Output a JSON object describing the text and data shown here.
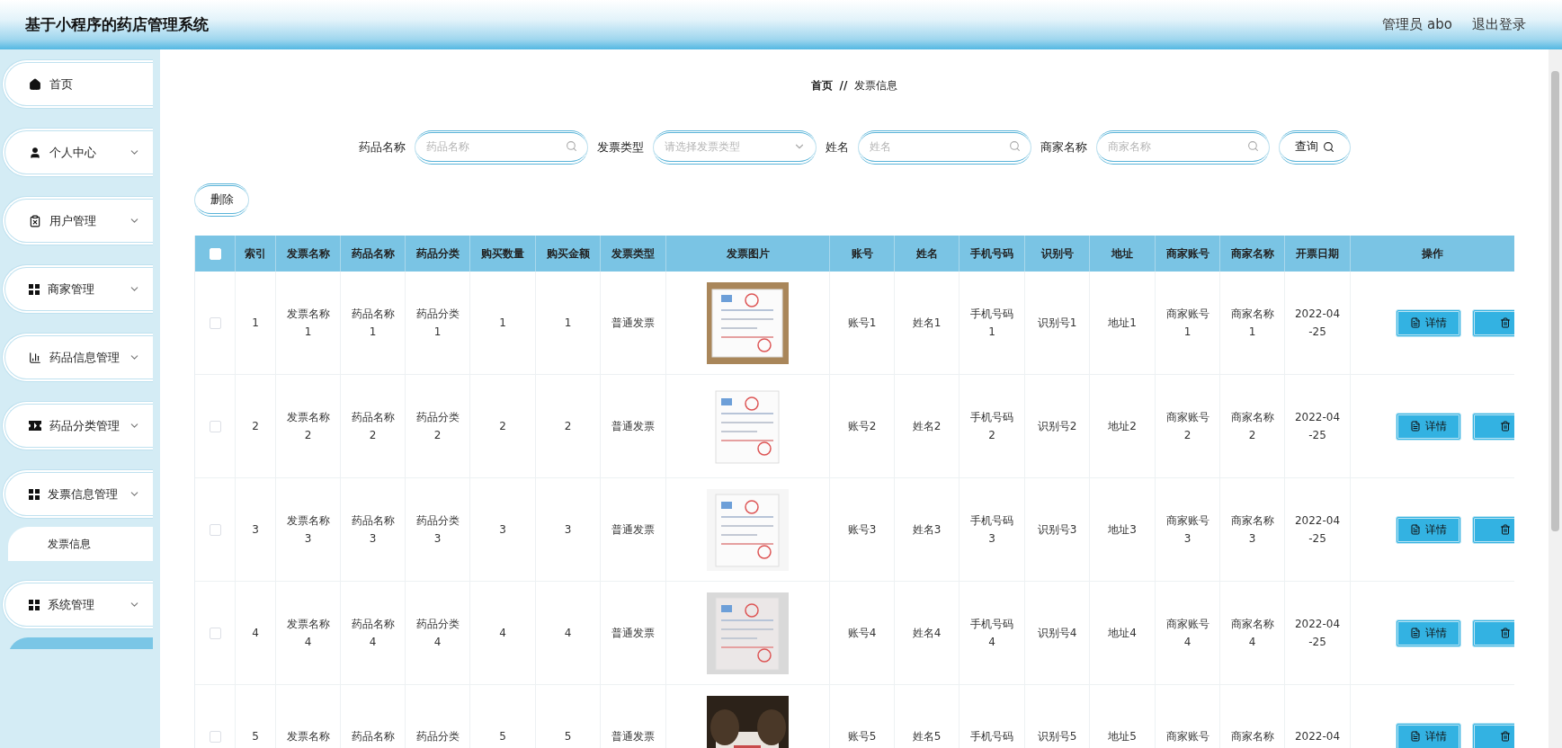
{
  "header": {
    "title": "基于小程序的药店管理系统",
    "user": "管理员 abo",
    "logout": "退出登录"
  },
  "sidebar": {
    "items": [
      {
        "label": "首页",
        "kind": "link"
      },
      {
        "label": "个人中心",
        "kind": "menu"
      },
      {
        "label": "用户管理",
        "kind": "menu"
      },
      {
        "label": "商家管理",
        "kind": "menu"
      },
      {
        "label": "药品信息管理",
        "kind": "menu"
      },
      {
        "label": "药品分类管理",
        "kind": "menu"
      },
      {
        "label": "发票信息管理",
        "kind": "menu",
        "children": [
          {
            "label": "发票信息",
            "selected": false
          }
        ]
      },
      {
        "label": "系统管理",
        "kind": "menu",
        "children": [
          {
            "selected": true
          }
        ]
      }
    ]
  },
  "breadcrumb": {
    "items": [
      "首页",
      "发票信息"
    ],
    "separator": "//"
  },
  "search": {
    "fields": [
      {
        "label": "药品名称",
        "placeholder": "药品名称",
        "kind": "text"
      },
      {
        "label": "发票类型",
        "placeholder": "请选择发票类型",
        "kind": "select"
      },
      {
        "label": "姓名",
        "placeholder": "姓名",
        "kind": "text"
      },
      {
        "label": "商家名称",
        "placeholder": "商家名称",
        "kind": "text"
      }
    ],
    "button": "查询"
  },
  "toolbar": {
    "delete_button": "删除"
  },
  "table": {
    "all_checked": false,
    "columns": [
      "索引",
      "发票名称",
      "药品名称",
      "药品分类",
      "购买数量",
      "购买金额",
      "发票类型",
      "发票图片",
      "账号",
      "姓名",
      "手机号码",
      "识别号",
      "地址",
      "商家账号",
      "商家名称",
      "开票日期",
      "操作"
    ],
    "rows": [
      {
        "checked": false,
        "cells": [
          "1",
          "发票名称1",
          "药品名称1",
          "药品分类1",
          "1",
          "1",
          "普通发票",
          {
            "kind": "picture"
          },
          "账号1",
          "姓名1",
          "手机号码1",
          "识别号1",
          "地址1",
          "商家账号1",
          "商家名称1",
          "2022-04-25",
          {
            "kind": "actions",
            "buttons": [
              "详情"
            ]
          }
        ]
      },
      {
        "checked": false,
        "cells": [
          "2",
          "发票名称2",
          "药品名称2",
          "药品分类2",
          "2",
          "2",
          "普通发票",
          {
            "kind": "picture"
          },
          "账号2",
          "姓名2",
          "手机号码2",
          "识别号2",
          "地址2",
          "商家账号2",
          "商家名称2",
          "2022-04-25",
          {
            "kind": "actions",
            "buttons": [
              "详情"
            ]
          }
        ]
      },
      {
        "checked": false,
        "cells": [
          "3",
          "发票名称3",
          "药品名称3",
          "药品分类3",
          "3",
          "3",
          "普通发票",
          {
            "kind": "picture"
          },
          "账号3",
          "姓名3",
          "手机号码3",
          "识别号3",
          "地址3",
          "商家账号3",
          "商家名称3",
          "2022-04-25",
          {
            "kind": "actions",
            "buttons": [
              "详情"
            ]
          }
        ]
      },
      {
        "checked": false,
        "cells": [
          "4",
          "发票名称4",
          "药品名称4",
          "药品分类4",
          "4",
          "4",
          "普通发票",
          {
            "kind": "picture"
          },
          "账号4",
          "姓名4",
          "手机号码4",
          "识别号4",
          "地址4",
          "商家账号4",
          "商家名称4",
          "2022-04-25",
          {
            "kind": "actions",
            "buttons": [
              "详情"
            ]
          }
        ]
      },
      {
        "checked": false,
        "cells": [
          "5",
          "发票名称",
          "药品名称",
          "药品分类",
          "5",
          "5",
          "普通发票",
          {
            "kind": "picture"
          },
          "账号5",
          "姓名5",
          "手机号码",
          "识别号5",
          "地址5",
          "商家账号",
          "商家名称",
          "2022-04",
          {
            "kind": "actions",
            "buttons": [
              "详情"
            ]
          }
        ]
      }
    ]
  }
}
